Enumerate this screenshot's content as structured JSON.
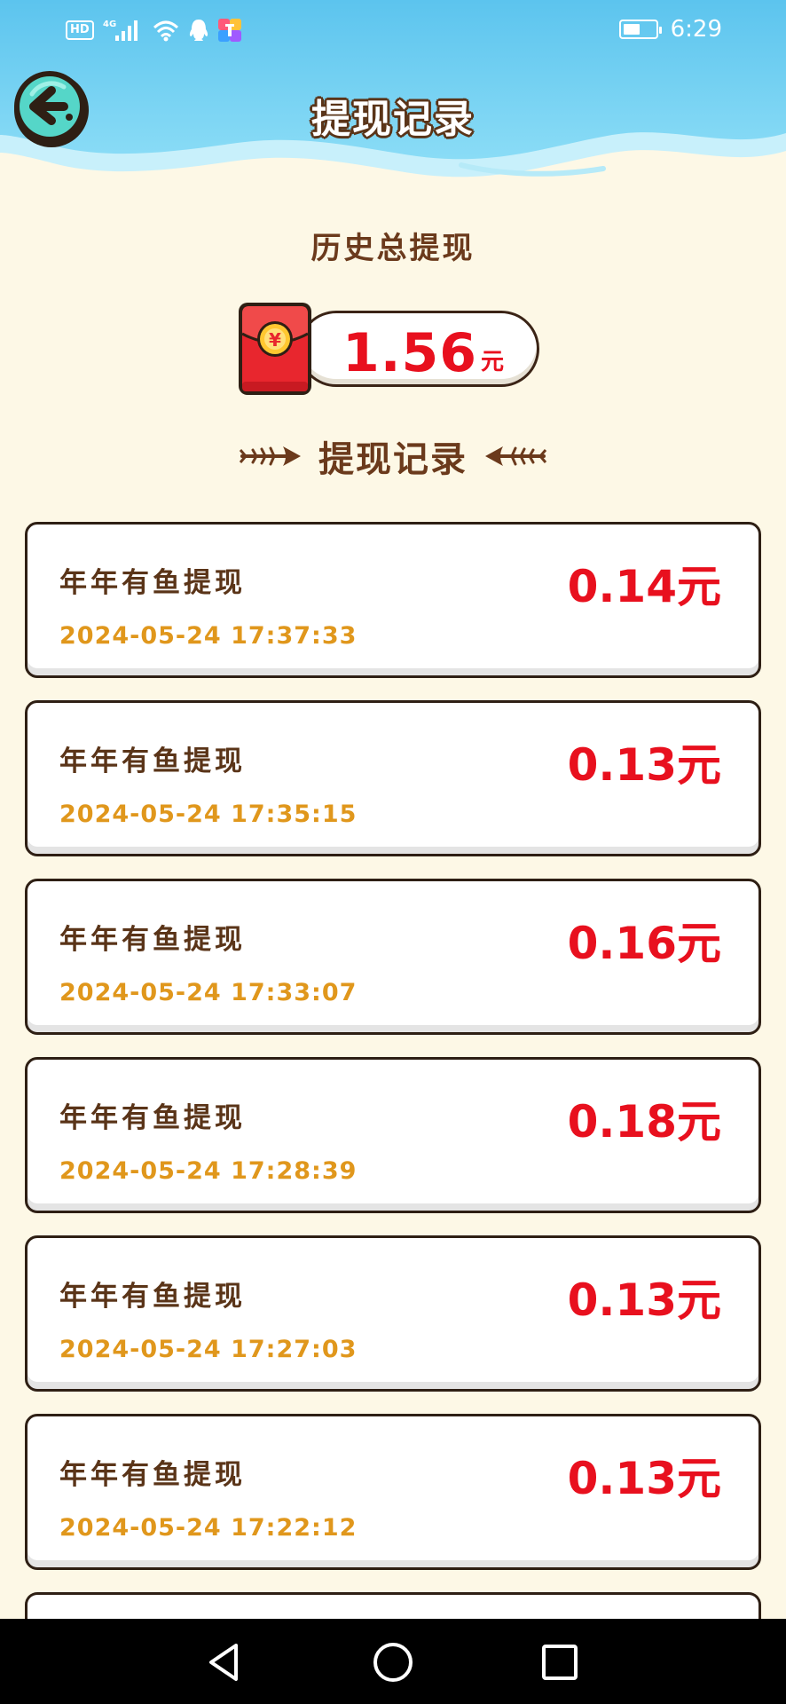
{
  "status_bar": {
    "network_badge": "HD",
    "network_type": "4G",
    "time": "6:29",
    "icons": [
      "signal-icon",
      "wifi-icon",
      "qq-icon",
      "app-icon",
      "battery-icon"
    ]
  },
  "header": {
    "title": "提现记录",
    "back_icon": "back-arrow-icon",
    "wave_color": "#7FD3F2"
  },
  "summary": {
    "label": "历史总提现",
    "amount": "1.56",
    "unit": "元",
    "redpacket_symbol": "¥"
  },
  "section": {
    "title": "提现记录"
  },
  "records": [
    {
      "name": "年年有鱼提现",
      "amount": "0.14元",
      "time": "2024-05-24 17:37:33"
    },
    {
      "name": "年年有鱼提现",
      "amount": "0.13元",
      "time": "2024-05-24 17:35:15"
    },
    {
      "name": "年年有鱼提现",
      "amount": "0.16元",
      "time": "2024-05-24 17:33:07"
    },
    {
      "name": "年年有鱼提现",
      "amount": "0.18元",
      "time": "2024-05-24 17:28:39"
    },
    {
      "name": "年年有鱼提现",
      "amount": "0.13元",
      "time": "2024-05-24 17:27:03"
    },
    {
      "name": "年年有鱼提现",
      "amount": "0.13元",
      "time": "2024-05-24 17:22:12"
    }
  ],
  "colors": {
    "background": "#FDF8E6",
    "brown": "#6B3A1C",
    "amount_red": "#E8101E",
    "time_orange": "#E0971C"
  },
  "nav_bar": {
    "buttons": [
      "back-triangle-icon",
      "home-circle-icon",
      "recents-square-icon"
    ]
  }
}
